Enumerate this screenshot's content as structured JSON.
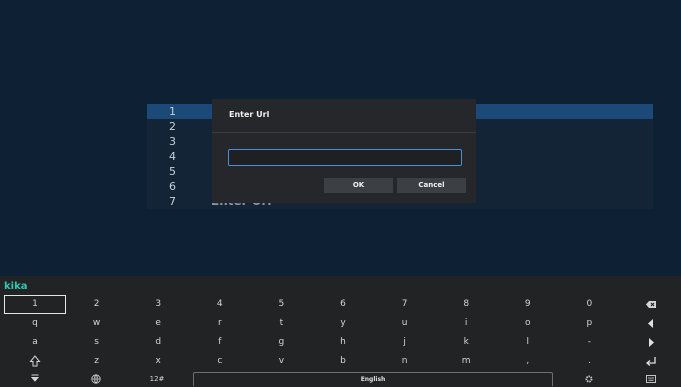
{
  "url_list": {
    "rows": [
      {
        "number": "1",
        "label": ""
      },
      {
        "number": "2",
        "label": ""
      },
      {
        "number": "3",
        "label": ""
      },
      {
        "number": "4",
        "label": ""
      },
      {
        "number": "5",
        "label": ""
      },
      {
        "number": "6",
        "label": ""
      },
      {
        "number": "7",
        "label": "Enter Url"
      }
    ],
    "selected_index": 0
  },
  "dialog": {
    "title": "Enter Url",
    "input_value": "",
    "ok_label": "OK",
    "cancel_label": "Cancel"
  },
  "keyboard": {
    "brand": "kika",
    "row1": [
      "1",
      "2",
      "3",
      "4",
      "5",
      "6",
      "7",
      "8",
      "9",
      "0"
    ],
    "row2": [
      "q",
      "w",
      "e",
      "r",
      "t",
      "y",
      "u",
      "i",
      "o",
      "p"
    ],
    "row3": [
      "a",
      "s",
      "d",
      "f",
      "g",
      "h",
      "j",
      "k",
      "l",
      "-"
    ],
    "row4": [
      "z",
      "x",
      "c",
      "v",
      "b",
      "n",
      "m",
      ",",
      "."
    ],
    "symbols_label": "12#",
    "space_label": "English",
    "icons": {
      "backspace": "backspace-icon",
      "left": "arrow-left-icon",
      "right": "arrow-right-icon",
      "enter": "enter-icon",
      "shift": "shift-icon",
      "hide": "hide-keyboard-icon",
      "globe": "globe-icon",
      "settings": "gear-icon",
      "clipboard": "keyboard-icon"
    }
  },
  "colors": {
    "screen_background": "#0e2033",
    "selection": "#1b4a78",
    "input_border": "#4d8fd1",
    "brand": "#2fc8b4"
  }
}
